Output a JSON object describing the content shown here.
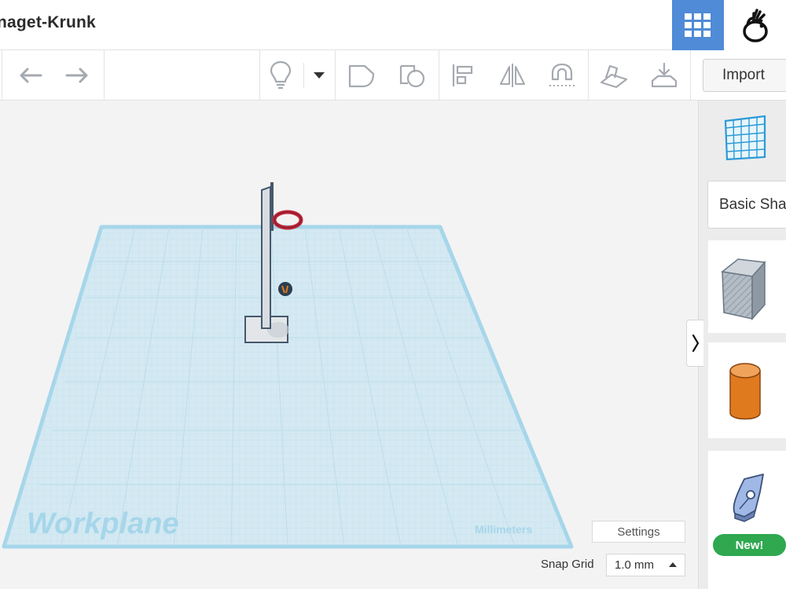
{
  "app": {
    "design_title": "naget-Krunk"
  },
  "header": {
    "grid_view_icon": "grid-icon",
    "user_icon": "tinkercad-user-icon"
  },
  "toolbar": {
    "import_label": "Import",
    "icons": [
      "undo-icon",
      "redo-icon",
      "lightbulb-icon",
      "dropdown-caret-icon",
      "group-shape-icon",
      "hole-shape-icon",
      "align-icon",
      "mirror-icon",
      "magnet-icon",
      "workplane-tool-icon",
      "ruler-drop-icon"
    ]
  },
  "workplane": {
    "label": "Workplane",
    "units_label": "Millimeters",
    "settings_label": "Settings",
    "snap_grid_label": "Snap Grid",
    "snap_grid_value": "1.0 mm",
    "colors": {
      "plane": "#cfe6f1",
      "plane_border": "#96cfe6",
      "hoop": "#c0293b",
      "pole": "#d8dde3",
      "ball": "#2c3e50"
    }
  },
  "sidebar": {
    "shape_category": "Basic Shapes",
    "new_badge": "New!",
    "shapes": [
      "workplane-grid-shape",
      "box-shape",
      "cylinder-shape",
      "shape-generator-shape"
    ],
    "colors": {
      "box": "#aab4bf",
      "cylinder": "#e07a1f",
      "generator": "#7a9bd3"
    }
  }
}
